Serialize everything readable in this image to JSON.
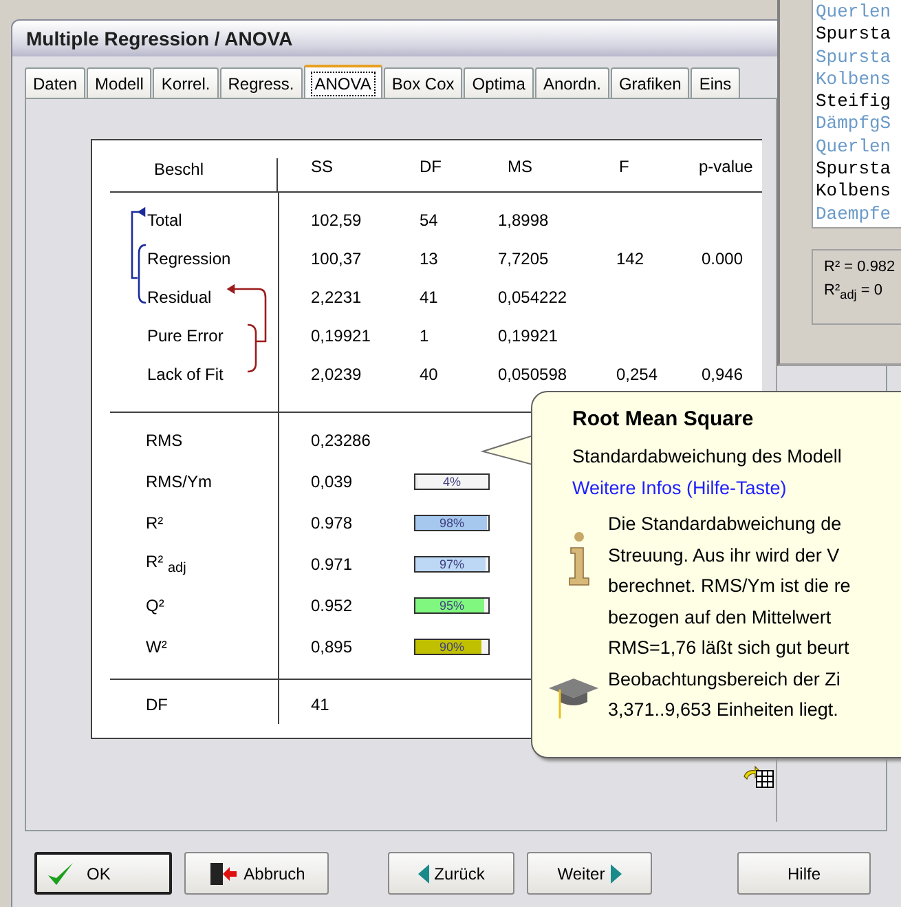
{
  "dialog": {
    "title": "Multiple Regression / ANOVA",
    "tabs": [
      {
        "label": "Daten",
        "selected": false
      },
      {
        "label": "Modell",
        "selected": false
      },
      {
        "label": "Korrel.",
        "selected": false
      },
      {
        "label": "Regress.",
        "selected": false
      },
      {
        "label": "ANOVA",
        "selected": true
      },
      {
        "label": "Box Cox",
        "selected": false
      },
      {
        "label": "Optima",
        "selected": false
      },
      {
        "label": "Anordn.",
        "selected": false
      },
      {
        "label": "Grafiken",
        "selected": false
      },
      {
        "label": "Eins",
        "selected": false
      }
    ],
    "table": {
      "columns": [
        "Beschl",
        "SS",
        "DF",
        "MS",
        "F",
        "p-value"
      ],
      "anova_rows": [
        {
          "label": "Total",
          "ss": "102,59",
          "df": "54",
          "ms": "1,8998"
        },
        {
          "label": "Regression",
          "ss": "100,37",
          "df": "13",
          "ms": "7,7205",
          "f": "142",
          "p_value": "0.000"
        },
        {
          "label": "Residual",
          "ss": "2,2231",
          "df": "41",
          "ms": "0,054222"
        },
        {
          "label": "Pure Error",
          "ss": "0,19921",
          "df": "1",
          "ms": "0,19921"
        },
        {
          "label": "Lack of Fit",
          "ss": "2,0239",
          "df": "40",
          "ms": "0,050598",
          "f": "0,254",
          "p_value": "0,946"
        }
      ],
      "fit_rows": [
        {
          "label": "RMS",
          "value": "0,23286"
        },
        {
          "label": "RMS/Ym",
          "value": "0,039",
          "bar": {
            "label": "4%",
            "level": 0.04,
            "color": "#ececec"
          }
        },
        {
          "label": "R²",
          "value": "0.978",
          "bar": {
            "label": "98%",
            "level": 0.98,
            "color": "#a6c8ee"
          }
        },
        {
          "label": "R² $_{adj}$",
          "value": "0.971",
          "bar": {
            "label": "97%",
            "level": 0.97,
            "color": "#bcd8f4"
          }
        },
        {
          "label": "Q²",
          "value": "0.952",
          "bar": {
            "label": "95%",
            "level": 0.95,
            "color": "#80f880"
          }
        },
        {
          "label": "W²",
          "value": "0,895",
          "bar": {
            "label": "90%",
            "level": 0.9,
            "color": "#c0c000"
          }
        }
      ],
      "df_row": {
        "label": "DF",
        "value": "41"
      }
    },
    "tooltip": {
      "title": "Root Mean Square",
      "subtitle": "Standardabweichung des Modell",
      "link": "Weitere Infos (Hilfe-Taste)",
      "lines": [
        "Die Standardabweichung de",
        "Streuung. Aus ihr wird der V",
        "berechnet. RMS/Ym ist die re",
        "bezogen auf den Mittelwert",
        "RMS=1,76 läßt sich gut beurt",
        "Beobachtungsbereich der Zi",
        "3,371..9,653 Einheiten liegt."
      ]
    },
    "buttons": [
      {
        "label": "OK",
        "kind": "ok"
      },
      {
        "label": "Abbruch",
        "kind": "cancel"
      },
      {
        "label": "Zurück",
        "kind": "back"
      },
      {
        "label": "Weiter",
        "kind": "next"
      },
      {
        "label": "Hilfe",
        "kind": "help"
      }
    ]
  },
  "side_window": {
    "list_items": [
      {
        "text": "Querlen",
        "color": "#6a9ac8"
      },
      {
        "text": "Spursta",
        "color": "#000000"
      },
      {
        "text": "Spursta",
        "color": "#6a9ac8"
      },
      {
        "text": "Kolbens",
        "color": "#6a9ac8"
      },
      {
        "text": "Steifig",
        "color": "#000000"
      },
      {
        "text": "DämpfgS",
        "color": "#6a9ac8"
      },
      {
        "text": "Querlen",
        "color": "#6a9ac8"
      },
      {
        "text": "Spursta",
        "color": "#000000"
      },
      {
        "text": "Kolbens",
        "color": "#000000"
      },
      {
        "text": "Daempfe",
        "color": "#6a9ac8"
      }
    ],
    "fit_lines": [
      "R² = 0.982",
      "R²$_{adj}$ = 0"
    ]
  }
}
